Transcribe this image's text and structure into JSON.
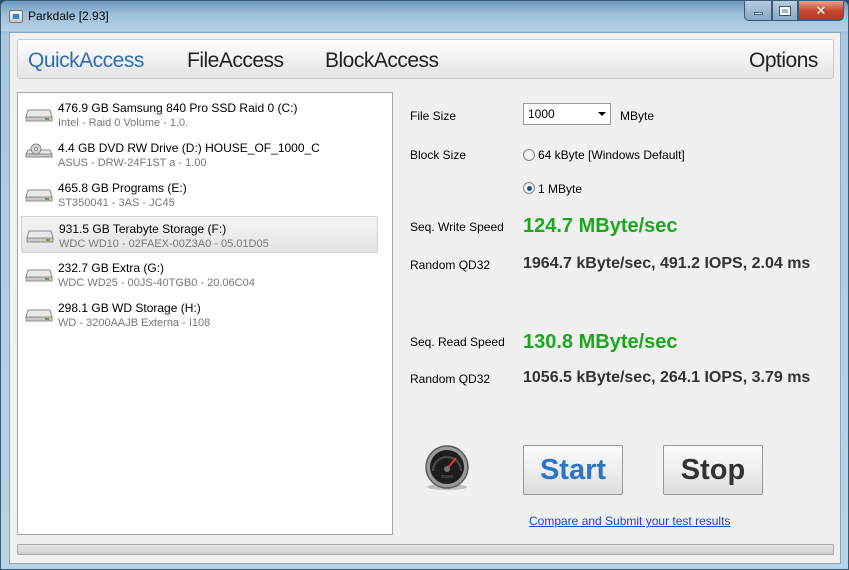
{
  "window": {
    "title": "Parkdale [2.93]"
  },
  "tabs": [
    {
      "label": "QuickAccess",
      "active": true
    },
    {
      "label": "FileAccess",
      "active": false
    },
    {
      "label": "BlockAccess",
      "active": false
    },
    {
      "label": "Options",
      "active": false
    }
  ],
  "drives": [
    {
      "name": "476.9 GB Samsung 840 Pro SSD Raid 0 (C:)",
      "sub": "Intel - Raid 0 Volume - 1.0.",
      "kind": "hdd-icon",
      "selected": false
    },
    {
      "name": "4.4 GB DVD RW Drive (D:) HOUSE_OF_1000_C",
      "sub": "ASUS - DRW-24F1ST   a - 1.00",
      "kind": "dvd-drive-icon",
      "selected": false
    },
    {
      "name": "465.8 GB Programs (E:)",
      "sub": "ST350041 - 3AS - JC45",
      "kind": "hdd-icon",
      "selected": false
    },
    {
      "name": "931.5 GB Terabyte Storage (F:)",
      "sub": "WDC WD10 - 02FAEX-00Z3A0 - 05.01D05",
      "kind": "hdd-icon",
      "selected": true
    },
    {
      "name": "232.7 GB Extra (G:)",
      "sub": "WDC WD25 - 00JS-40TGB0 - 20.06C04",
      "kind": "hdd-icon",
      "selected": false
    },
    {
      "name": "298.1 GB WD Storage (H:)",
      "sub": "WD - 3200AAJB Externa - I108",
      "kind": "hdd-icon",
      "selected": false
    }
  ],
  "settings": {
    "file_size_label": "File Size",
    "file_size_value": "1000",
    "file_size_unit": "MByte",
    "block_size_label": "Block Size",
    "block_options": [
      {
        "label": "64 kByte [Windows Default]",
        "checked": false
      },
      {
        "label": "1 MByte",
        "checked": true
      }
    ]
  },
  "results": {
    "seq_write_label": "Seq. Write Speed",
    "seq_write_value": "124.7 MByte/sec",
    "random_write_label": "Random QD32",
    "random_write_value": "1964.7 kByte/sec, 491.2 IOPS, 2.04 ms",
    "seq_read_label": "Seq. Read Speed",
    "seq_read_value": "130.8 MByte/sec",
    "random_read_label": "Random QD32",
    "random_read_value": "1056.5 kByte/sec, 264.1 IOPS, 3.79 ms"
  },
  "actions": {
    "start_label": "Start",
    "stop_label": "Stop",
    "compare_link": "Compare and Submit your test results"
  },
  "progress": {
    "fraction": 0
  },
  "colors": {
    "active_tab": "#2e6fb5",
    "speed_green": "#1ca81c",
    "start_blue": "#2e74c4",
    "link_blue": "#1a47c6"
  }
}
